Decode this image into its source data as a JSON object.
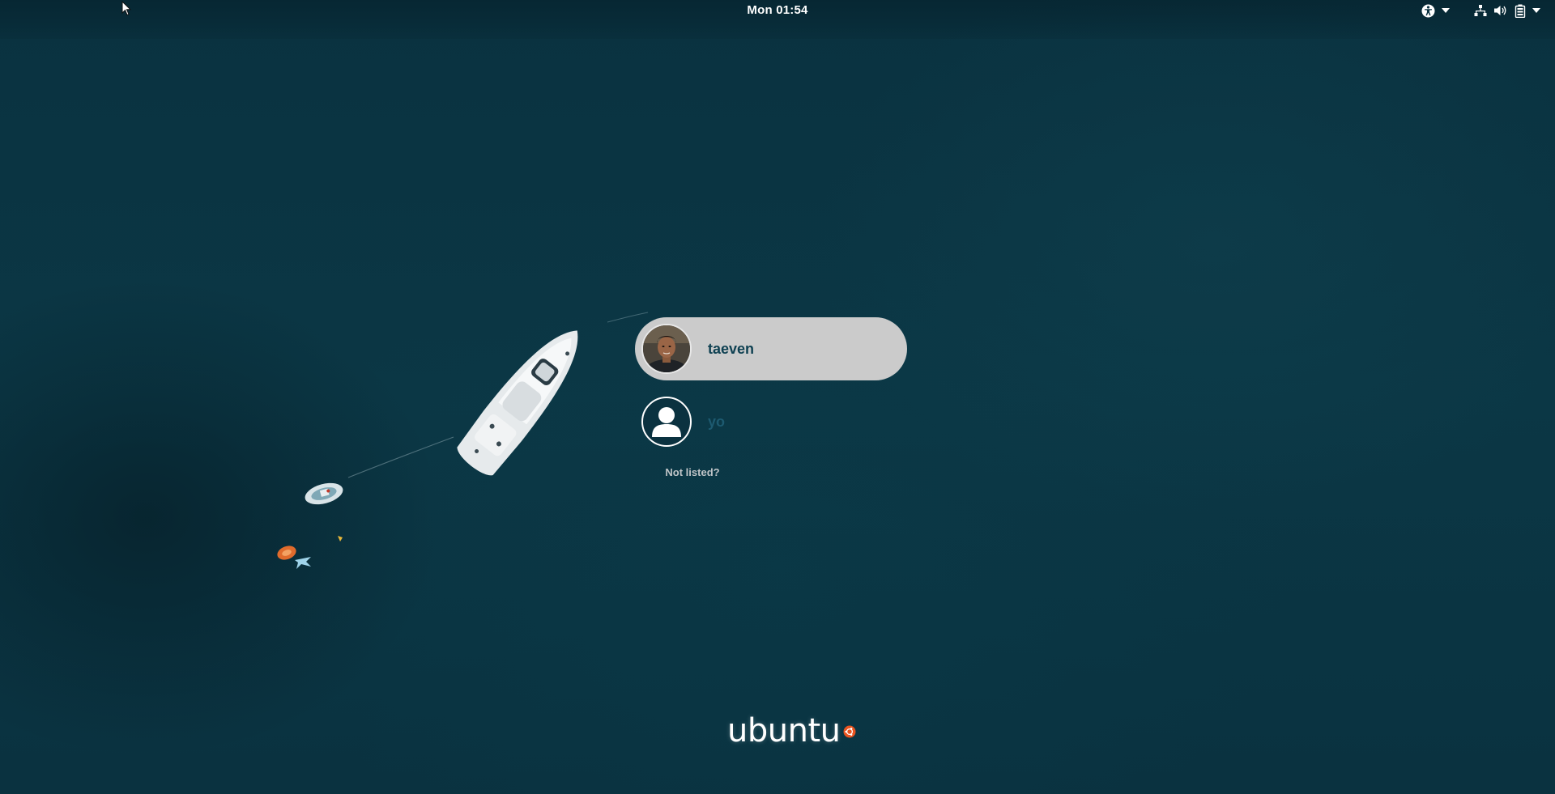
{
  "topbar": {
    "clock": "Mon 01:54",
    "tray": {
      "accessibility_icon": "accessibility-icon",
      "network_icon": "network-wired-icon",
      "volume_icon": "volume-icon",
      "battery_icon": "battery-icon"
    }
  },
  "users": [
    {
      "name": "taeven",
      "selected": true,
      "avatar": "photo"
    },
    {
      "name": "yo",
      "selected": false,
      "avatar": "generic-user-icon"
    }
  ],
  "not_listed_label": "Not listed?",
  "branding": {
    "wordmark": "ubuntu"
  },
  "colors": {
    "background": "#0a3341",
    "selected_item": "#cbcbcb",
    "username": "#0f4152"
  }
}
